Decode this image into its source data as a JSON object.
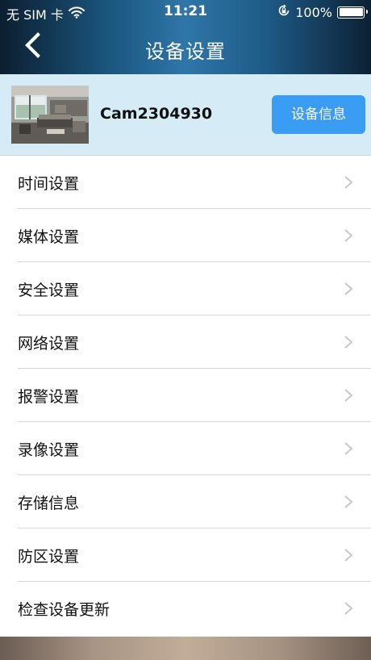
{
  "status_bar": {
    "carrier": "无 SIM 卡",
    "time": "11:21",
    "battery_percent": "100%"
  },
  "header": {
    "title": "设备设置"
  },
  "device": {
    "name": "Cam2304930",
    "info_button_label": "设备信息"
  },
  "settings_items": [
    {
      "label": "时间设置"
    },
    {
      "label": "媒体设置"
    },
    {
      "label": "安全设置"
    },
    {
      "label": "网络设置"
    },
    {
      "label": "报警设置"
    },
    {
      "label": "录像设置"
    },
    {
      "label": "存储信息"
    },
    {
      "label": "防区设置"
    },
    {
      "label": "检查设备更新"
    }
  ],
  "icons": {
    "back": "chevron-left-icon",
    "wifi": "wifi-icon",
    "orientation_lock": "orientation-lock-icon",
    "battery": "battery-icon",
    "row_chevron": "chevron-right-icon"
  },
  "colors": {
    "header_bg": "#1b5780",
    "device_card_bg": "#d5ecf7",
    "info_button_bg": "#3b9cf4",
    "chevron": "#c7c7cc"
  }
}
